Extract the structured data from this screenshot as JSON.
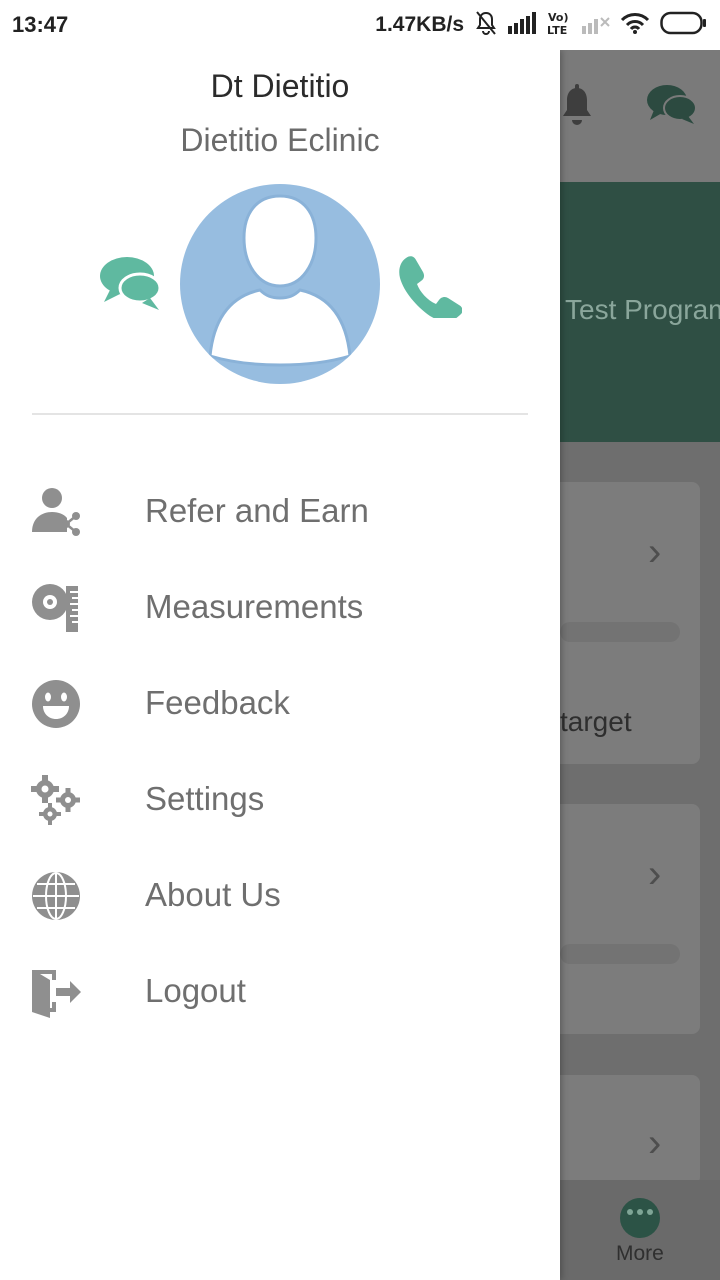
{
  "status_bar": {
    "time": "13:47",
    "speed": "1.47KB/s",
    "icons": [
      "mute-icon",
      "signal-icon",
      "volte-icon",
      "signal-weak-icon",
      "wifi-icon",
      "battery-icon"
    ]
  },
  "drawer": {
    "doctor_name": "Dt Dietitio",
    "clinic_name": "Dietitio Eclinic",
    "accent_color": "#5fb9a0",
    "menu": [
      {
        "label": "Refer and Earn",
        "icon": "refer-share-icon"
      },
      {
        "label": "Measurements",
        "icon": "measuring-tape-icon"
      },
      {
        "label": "Feedback",
        "icon": "smiley-icon"
      },
      {
        "label": "Settings",
        "icon": "gears-icon"
      },
      {
        "label": "About Us",
        "icon": "globe-icon"
      },
      {
        "label": "Logout",
        "icon": "logout-door-icon"
      }
    ]
  },
  "background": {
    "banner_text": "Test Program",
    "card_text": "target",
    "bottom_nav_more": "More"
  }
}
